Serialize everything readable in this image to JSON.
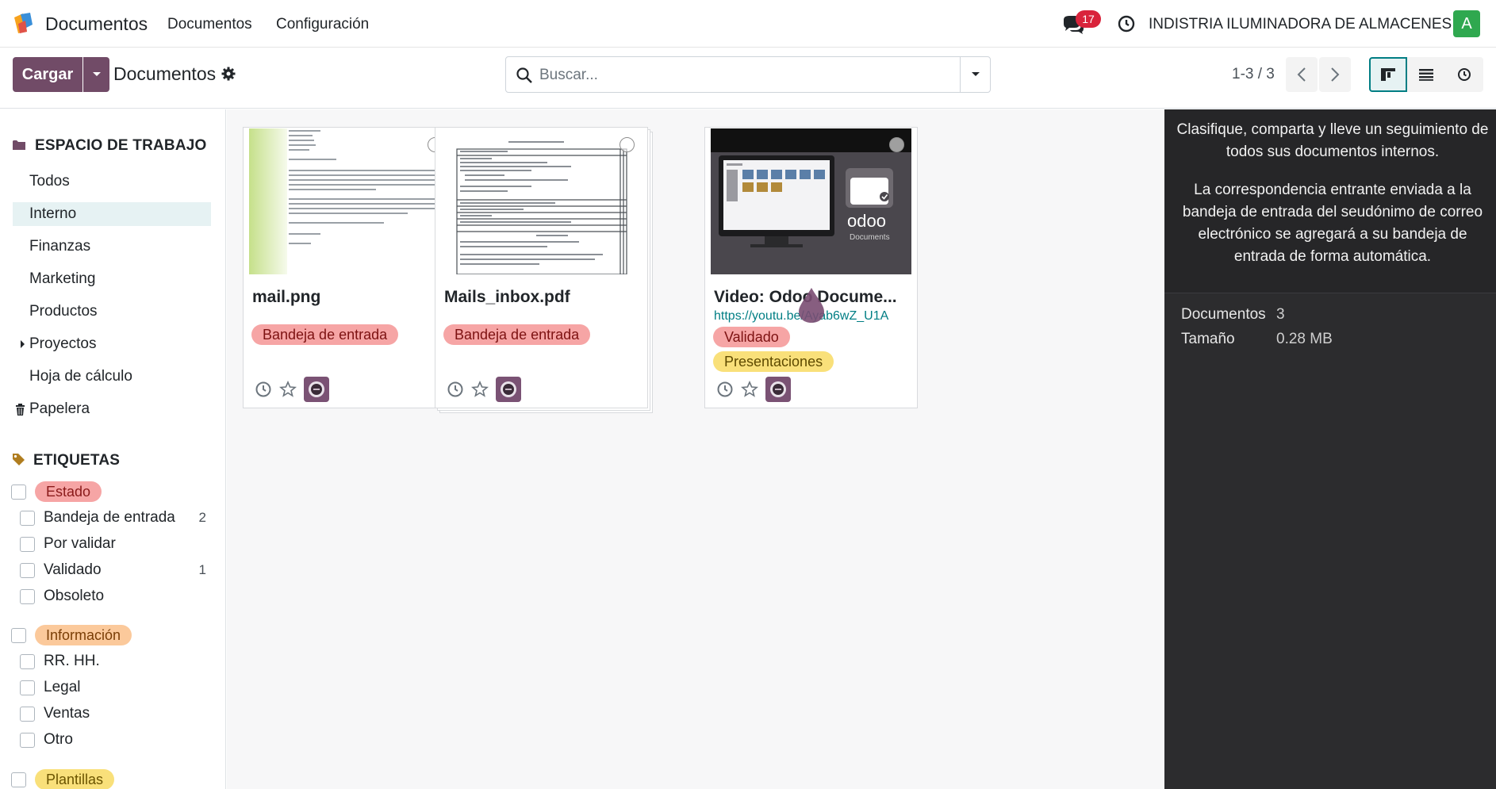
{
  "navbar": {
    "app_name": "Documentos",
    "menu": [
      "Documentos",
      "Configuración"
    ],
    "chat_count": "17",
    "company": "INDISTRIA ILUMINADORA DE ALMACENES",
    "avatar_letter": "A"
  },
  "control_panel": {
    "upload_label": "Cargar",
    "title": "Documentos",
    "search_placeholder": "Buscar...",
    "pager": "1-3 / 3"
  },
  "sidebar": {
    "workspace_title": "ESPACIO DE TRABAJO",
    "workspaces": [
      "Todos",
      "Interno",
      "Finanzas",
      "Marketing",
      "Productos",
      "Proyectos",
      "Hoja de cálculo",
      "Papelera"
    ],
    "active_workspace": "Interno",
    "tags_title": "ETIQUETAS",
    "tag_groups": [
      {
        "name": "Estado",
        "color": "#f6a5a5",
        "items": [
          {
            "label": "Bandeja de entrada",
            "count": "2"
          },
          {
            "label": "Por validar",
            "count": ""
          },
          {
            "label": "Validado",
            "count": "1"
          },
          {
            "label": "Obsoleto",
            "count": ""
          }
        ]
      },
      {
        "name": "Información",
        "color": "#fbc99b",
        "items": [
          {
            "label": "RR. HH.",
            "count": ""
          },
          {
            "label": "Legal",
            "count": ""
          },
          {
            "label": "Ventas",
            "count": ""
          },
          {
            "label": "Otro",
            "count": ""
          }
        ]
      },
      {
        "name": "Plantillas",
        "color": "#f9e07a",
        "items": []
      }
    ]
  },
  "cards": [
    {
      "name": "mail.png",
      "url": "",
      "tags": [
        {
          "label": "Bandeja de entrada",
          "color": "#f6a5a5"
        }
      ]
    },
    {
      "name": "Mails_inbox.pdf",
      "url": "",
      "tags": [
        {
          "label": "Bandeja de entrada",
          "color": "#f6a5a5"
        }
      ]
    },
    {
      "name": "Video: Odoo Docume...",
      "url": "https://youtu.be/Ayab6wZ_U1A",
      "tags": [
        {
          "label": "Validado",
          "color": "#f6a5a5"
        },
        {
          "label": "Presentaciones",
          "color": "#f9e07a"
        }
      ]
    }
  ],
  "info_panel": {
    "text1": "Clasifique, comparta y lleve un seguimiento de todos sus documentos internos.",
    "text2": "La correspondencia entrante enviada a la bandeja de entrada del seudónimo de correo electrónico se agregará a su bandeja de entrada de forma automática.",
    "stats": [
      {
        "label": "Documentos",
        "value": "3"
      },
      {
        "label": "Tamaño",
        "value": "0.28 MB"
      }
    ]
  },
  "colors": {
    "brand": "#714b67",
    "accent": "#017e84"
  }
}
